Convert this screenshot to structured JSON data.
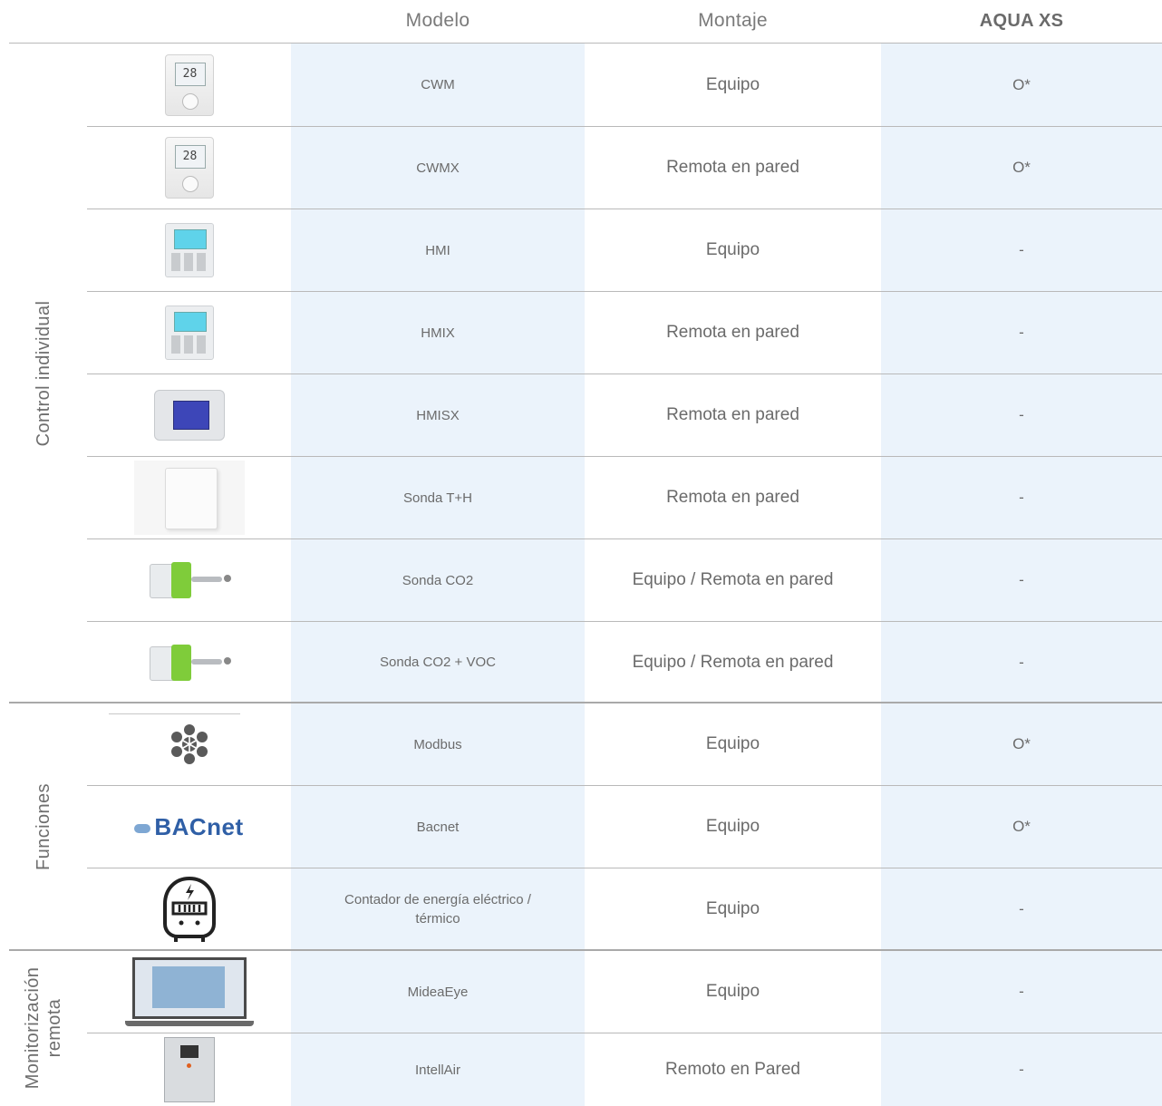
{
  "header": {
    "model": "Modelo",
    "mounting": "Montaje",
    "aqua": "AQUA XS"
  },
  "groups": {
    "control": "Control individual",
    "functions": "Funciones",
    "remote_line1": "Monitorización",
    "remote_line2": "remota"
  },
  "rows": [
    {
      "model": "CWM",
      "mounting": "Equipo",
      "aqua": "O*",
      "icon": "thermostat-icon"
    },
    {
      "model": "CWMX",
      "mounting": "Remota en pared",
      "aqua": "O*",
      "icon": "thermostat-icon"
    },
    {
      "model": "HMI",
      "mounting": "Equipo",
      "aqua": "-",
      "icon": "hmi-panel-icon"
    },
    {
      "model": "HMIX",
      "mounting": "Remota en pared",
      "aqua": "-",
      "icon": "hmi-panel-icon"
    },
    {
      "model": "HMISX",
      "mounting": "Remota en pared",
      "aqua": "-",
      "icon": "hmisx-panel-icon"
    },
    {
      "model": "Sonda T+H",
      "mounting": "Remota en pared",
      "aqua": "-",
      "icon": "wall-sensor-icon"
    },
    {
      "model": "Sonda CO2",
      "mounting": "Equipo / Remota en pared",
      "aqua": "-",
      "icon": "co2-probe-icon"
    },
    {
      "model": "Sonda CO2 + VOC",
      "mounting": "Equipo / Remota en pared",
      "aqua": "-",
      "icon": "co2-probe-icon"
    },
    {
      "model": "Modbus",
      "mounting": "Equipo",
      "aqua": "O*",
      "icon": "modbus-icon"
    },
    {
      "model": "Bacnet",
      "mounting": "Equipo",
      "aqua": "O*",
      "icon": "bacnet-logo-icon"
    },
    {
      "model": "Contador de energía eléctrico / térmico",
      "mounting": "Equipo",
      "aqua": "-",
      "icon": "energy-meter-icon"
    },
    {
      "model": "MideaEye",
      "mounting": "Equipo",
      "aqua": "-",
      "icon": "laptop-icon"
    },
    {
      "model": "IntellAir",
      "mounting": "Remoto en Pared",
      "aqua": "-",
      "icon": "control-cabinet-icon"
    }
  ],
  "images": {
    "thermo_display": "28",
    "bacnet_text": "BACnet"
  },
  "colors": {
    "band": "#ebf3fb",
    "text": "#6b6b6b",
    "rule": "#b9b9b9",
    "bacnet_blue": "#2f5fa6",
    "co2_green": "#7fcc3a",
    "hmisx_screen": "#3d46b8",
    "hmi_screen": "#5fd3ea"
  }
}
